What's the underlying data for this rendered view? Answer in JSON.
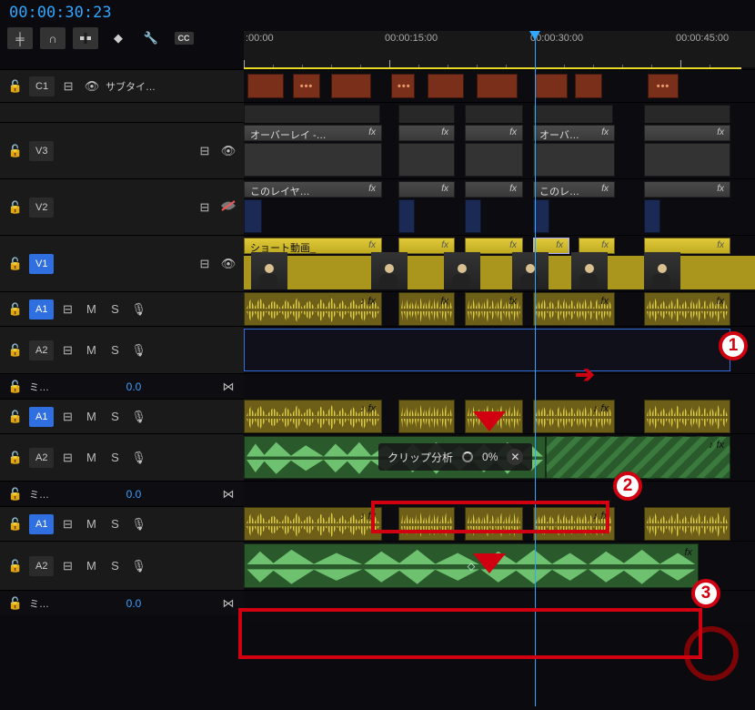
{
  "timecode": "00:00:30:23",
  "ruler": {
    "start": ":00:00",
    "t1": "00:00:15:00",
    "t2": "00:00:30:00",
    "t3": "00:00:45:00"
  },
  "toolbar_icons": {
    "snap": "⇔",
    "magnet": "∩",
    "link": "⛓",
    "marker": "◆",
    "wrench": "🔧",
    "cc": "CC"
  },
  "tracks": {
    "c1": {
      "label": "C1",
      "name": "サブタイ…"
    },
    "v3": {
      "label": "V3",
      "clip": "オーバーレイ -…",
      "clip2": "オーバ…"
    },
    "v2": {
      "label": "V2",
      "clip": "このレイヤ…",
      "clip2": "このレ…"
    },
    "v1": {
      "label": "V1",
      "clip": "ショート動画_"
    },
    "a1": {
      "label": "A1",
      "m": "M",
      "s": "S"
    },
    "a2": {
      "label": "A2",
      "m": "M",
      "s": "S"
    },
    "mix": {
      "label": "ミ…",
      "value": "0.0"
    }
  },
  "fx": "fx",
  "analysis": {
    "label": "クリップ分析",
    "pct": "0%",
    "close": "✕"
  },
  "annotations": {
    "one": "1",
    "two": "2",
    "three": "3"
  }
}
